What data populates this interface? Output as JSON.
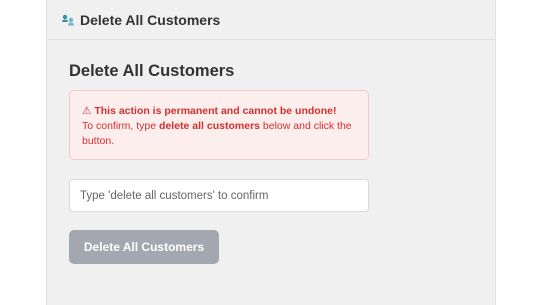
{
  "window": {
    "title": "Delete All Customers",
    "icon": "people-icon"
  },
  "main": {
    "heading": "Delete All Customers",
    "warning": {
      "symbol": "⚠",
      "title": "This action is permanent and cannot be undone!",
      "line_prefix": "To confirm, type ",
      "phrase": "delete all customers",
      "line_suffix": " below and click the button."
    },
    "confirm_input": {
      "value": "",
      "placeholder": "Type 'delete all customers' to confirm"
    },
    "delete_button": {
      "label": "Delete All Customers",
      "state": "disabled"
    }
  },
  "colors": {
    "warning_text": "#d32f2f",
    "warning_bg": "#fdeeee",
    "warning_border": "#f5c6cb",
    "button_disabled_bg": "#a2a7b0",
    "app_icon": "#3a8fa3"
  }
}
